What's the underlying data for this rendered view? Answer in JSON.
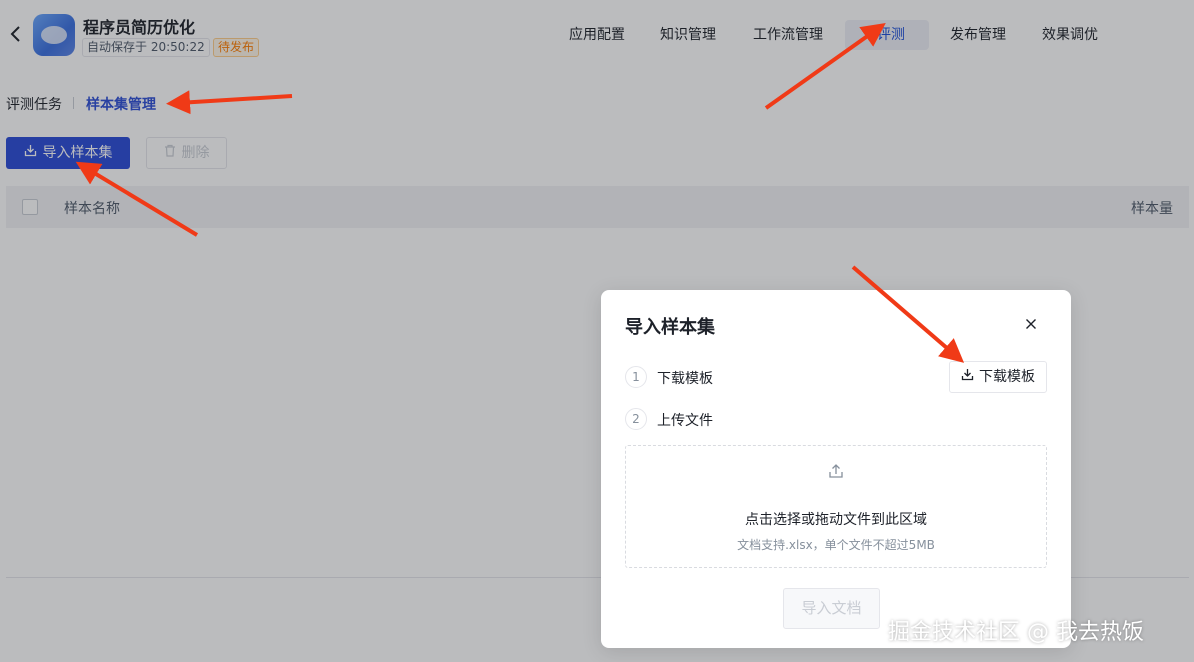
{
  "header": {
    "back_icon": "chevron-left-icon",
    "app_name": "程序员简历优化",
    "autosave": "自动保存于 20:50:22",
    "status": "待发布",
    "nav": [
      {
        "label": "应用配置",
        "active": false
      },
      {
        "label": "知识管理",
        "active": false
      },
      {
        "label": "工作流管理",
        "active": false
      },
      {
        "label": "评测",
        "active": true
      },
      {
        "label": "发布管理",
        "active": false
      },
      {
        "label": "效果调优",
        "active": false
      }
    ]
  },
  "subtabs": [
    {
      "label": "评测任务",
      "active": false
    },
    {
      "label": "样本集管理",
      "active": true
    }
  ],
  "toolbar": {
    "import_label": "导入样本集",
    "import_icon": "import-icon",
    "delete_label": "删除",
    "delete_icon": "trash-icon"
  },
  "table": {
    "columns": [
      "样本名称",
      "样本量"
    ]
  },
  "modal": {
    "title": "导入样本集",
    "close_icon": "close-icon",
    "steps": [
      {
        "num": "1",
        "label": "下载模板"
      },
      {
        "num": "2",
        "label": "上传文件"
      }
    ],
    "download_button": "下载模板",
    "download_icon": "download-icon",
    "upload": {
      "icon": "upload-icon",
      "title": "点击选择或拖动文件到此区域",
      "hint": "文档支持.xlsx，单个文件不超过5MB"
    },
    "import_button": "导入文档"
  },
  "annotation_color": "#f03a17",
  "watermark": "掘金技术社区 @ 我去热饭"
}
